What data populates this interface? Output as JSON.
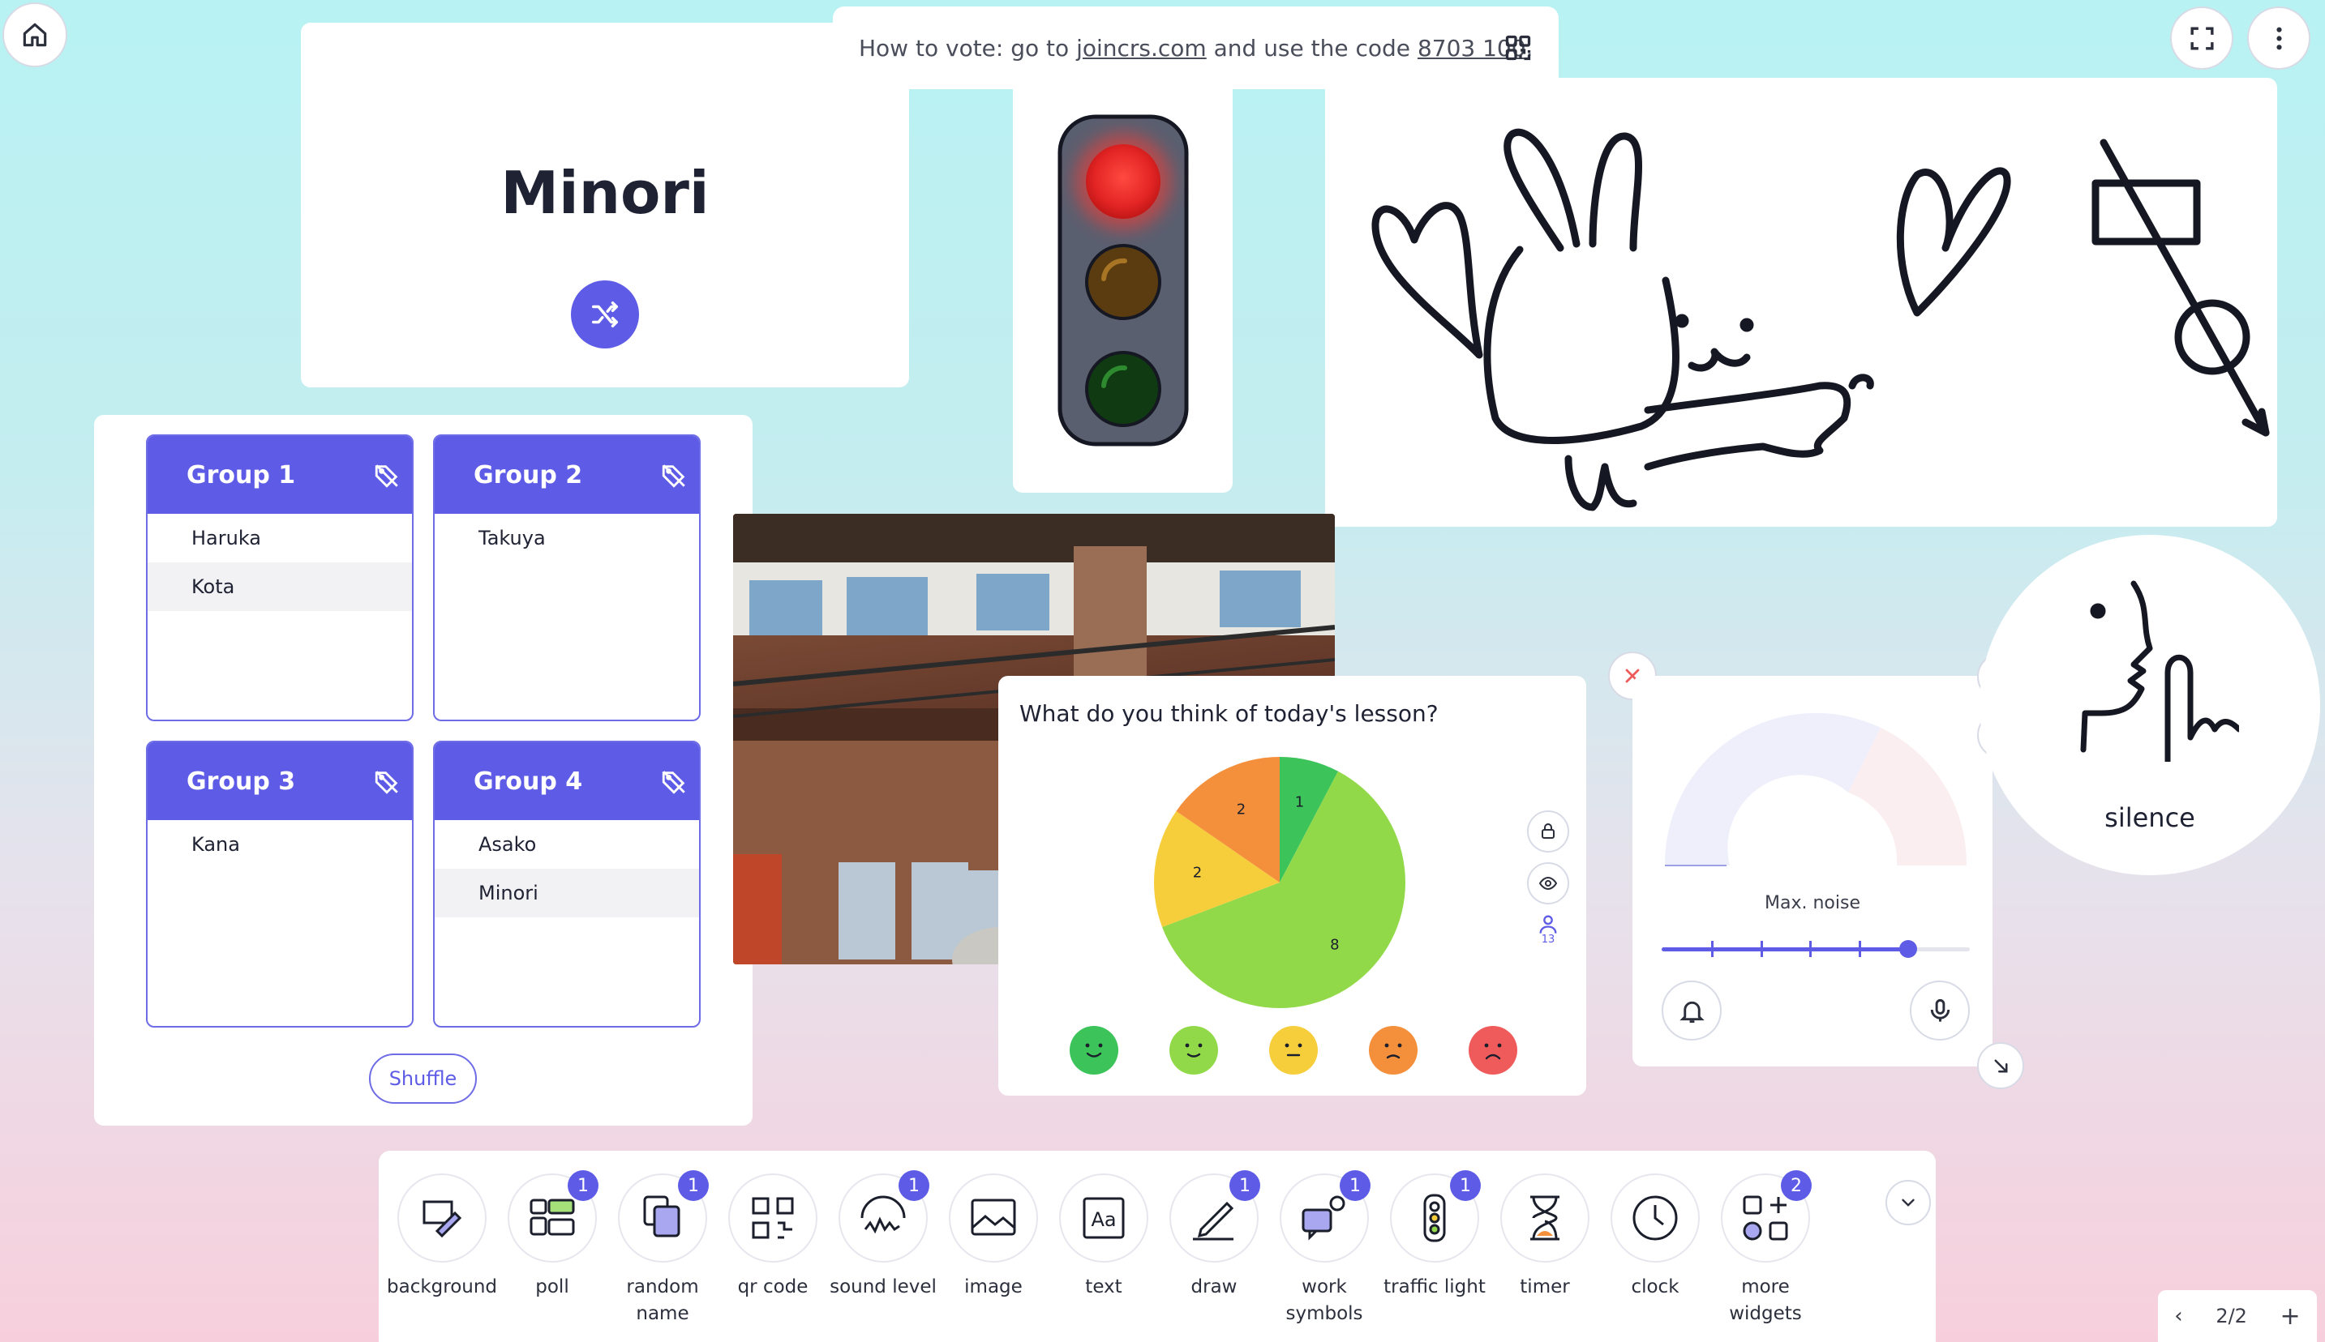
{
  "vote": {
    "prefix": "How to vote: go to",
    "site": "joincrs.com",
    "middle": "and use the code",
    "code": "8703 100",
    "suffix": "."
  },
  "random_name": {
    "name": "Minori"
  },
  "groups": [
    {
      "title": "Group 1",
      "members": [
        "Haruka",
        "Kota"
      ]
    },
    {
      "title": "Group 2",
      "members": [
        "Takuya"
      ]
    },
    {
      "title": "Group 3",
      "members": [
        "Kana"
      ]
    },
    {
      "title": "Group 4",
      "members": [
        "Asako",
        "Minori"
      ]
    }
  ],
  "groups_shuffle_label": "Shuffle",
  "poll": {
    "question": "What do you think of today's lesson?",
    "participants": "13"
  },
  "chart_data": {
    "type": "pie",
    "categories": [
      "very happy",
      "happy",
      "neutral",
      "unhappy",
      "very unhappy"
    ],
    "values": [
      1,
      8,
      2,
      2,
      0
    ],
    "colors": [
      "#3cc35a",
      "#92d94a",
      "#f6ce3c",
      "#f48f3c",
      "#ef5b5b"
    ]
  },
  "sound_level": {
    "label": "Max. noise",
    "slider_fraction": 0.8
  },
  "silence": {
    "label": "silence"
  },
  "toolbar": {
    "items": [
      {
        "id": "background",
        "label": "background",
        "badge": ""
      },
      {
        "id": "poll",
        "label": "poll",
        "badge": "1"
      },
      {
        "id": "random-name",
        "label": "random name",
        "badge": "1"
      },
      {
        "id": "qr-code",
        "label": "qr code",
        "badge": ""
      },
      {
        "id": "sound-level",
        "label": "sound level",
        "badge": "1"
      },
      {
        "id": "image",
        "label": "image",
        "badge": ""
      },
      {
        "id": "text",
        "label": "text",
        "badge": ""
      },
      {
        "id": "draw",
        "label": "draw",
        "badge": "1"
      },
      {
        "id": "work-symbols",
        "label": "work symbols",
        "badge": "1"
      },
      {
        "id": "traffic-light",
        "label": "traffic light",
        "badge": "1"
      },
      {
        "id": "timer",
        "label": "timer",
        "badge": ""
      },
      {
        "id": "clock",
        "label": "clock",
        "badge": ""
      },
      {
        "id": "more-widgets",
        "label": "more widgets",
        "badge": "2"
      }
    ]
  },
  "pager": {
    "text": "2/2"
  },
  "icons": {
    "home": "home-icon",
    "fullscreen": "fullscreen-icon",
    "menu": "more-vertical-icon",
    "qr": "qr-icon",
    "shuffle": "shuffle-icon",
    "close": "close-icon",
    "settings": "gear-icon",
    "resize": "resize-arrow-icon"
  },
  "colors": {
    "accent": "#5e5ce6",
    "traffic_red": "#e62b2b"
  }
}
